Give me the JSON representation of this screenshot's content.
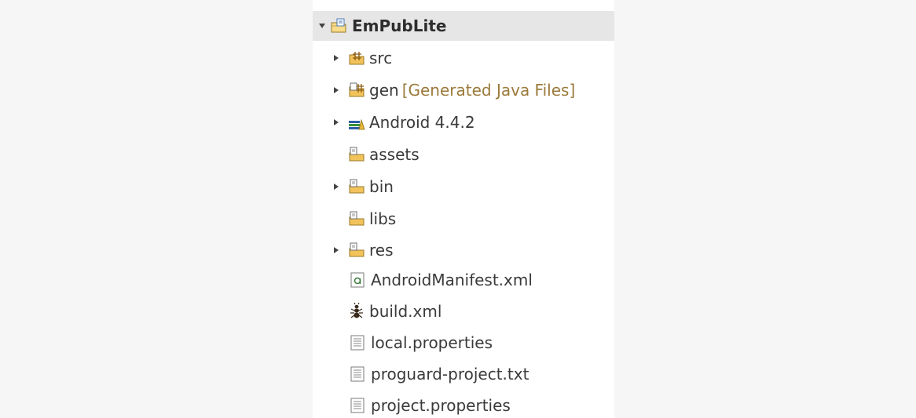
{
  "project_explorer": {
    "root": {
      "label": "EmPubLite",
      "expanded": true,
      "icon": "android-project-folder-icon"
    },
    "items": [
      {
        "label": "src",
        "decoration": "",
        "expandable": true,
        "icon": "source-folder-icon"
      },
      {
        "label": "gen",
        "decoration": "[Generated Java Files]",
        "expandable": true,
        "icon": "generated-source-folder-icon"
      },
      {
        "label": "Android 4.4.2",
        "decoration": "",
        "expandable": true,
        "icon": "library-container-icon"
      },
      {
        "label": "assets",
        "decoration": "",
        "expandable": false,
        "icon": "folder-icon"
      },
      {
        "label": "bin",
        "decoration": "",
        "expandable": true,
        "icon": "folder-icon"
      },
      {
        "label": "libs",
        "decoration": "",
        "expandable": false,
        "icon": "folder-icon"
      },
      {
        "label": "res",
        "decoration": "",
        "expandable": true,
        "icon": "folder-icon"
      },
      {
        "label": "AndroidManifest.xml",
        "decoration": "",
        "expandable": false,
        "icon": "manifest-file-icon"
      },
      {
        "label": "build.xml",
        "decoration": "",
        "expandable": false,
        "icon": "ant-build-file-icon"
      },
      {
        "label": "local.properties",
        "decoration": "",
        "expandable": false,
        "icon": "text-file-icon"
      },
      {
        "label": "proguard-project.txt",
        "decoration": "",
        "expandable": false,
        "icon": "text-file-icon"
      },
      {
        "label": "project.properties",
        "decoration": "",
        "expandable": false,
        "icon": "text-file-icon"
      }
    ]
  },
  "colors": {
    "decoration_text": "#9b7a3a",
    "folder_fill": "#f2c35b",
    "selection_bg": "#e6e6e6"
  }
}
